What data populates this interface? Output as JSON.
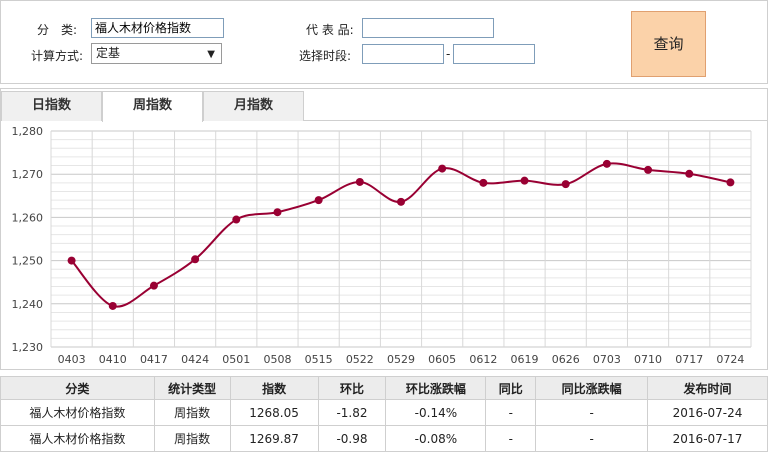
{
  "filters": {
    "category_label": "分　类:",
    "category_value": "福人木材价格指数",
    "calc_label": "计算方式:",
    "calc_value": "定基",
    "product_label": "代 表 品:",
    "product_value": "",
    "period_label": "选择时段:",
    "period_start": "",
    "period_sep": "-",
    "period_end": "",
    "query_label": "查询"
  },
  "tabs": [
    {
      "label": "日指数",
      "active": false
    },
    {
      "label": "周指数",
      "active": true
    },
    {
      "label": "月指数",
      "active": false
    }
  ],
  "chart_data": {
    "type": "line",
    "title": "",
    "xlabel": "",
    "ylabel": "",
    "categories": [
      "0403",
      "0410",
      "0417",
      "0424",
      "0501",
      "0508",
      "0515",
      "0522",
      "0529",
      "0605",
      "0612",
      "0619",
      "0626",
      "0703",
      "0710",
      "0717",
      "0724"
    ],
    "series": [
      {
        "values": [
          1250.0,
          1239.5,
          1244.2,
          1250.3,
          1259.5,
          1261.2,
          1264.0,
          1268.2,
          1263.6,
          1271.3,
          1268.0,
          1268.5,
          1267.7,
          1272.4,
          1271.0,
          1270.1,
          1268.1
        ],
        "color": "#990033"
      }
    ],
    "ylim": [
      1230,
      1280
    ],
    "yticks": [
      "1,230",
      "1,240",
      "1,250",
      "1,260",
      "1,270",
      "1,280"
    ],
    "grid": true
  },
  "table": {
    "headers": [
      "分类",
      "统计类型",
      "指数",
      "环比",
      "环比涨跌幅",
      "同比",
      "同比涨跌幅",
      "发布时间"
    ],
    "rows": [
      [
        "福人木材价格指数",
        "周指数",
        "1268.05",
        "-1.82",
        "-0.14%",
        "-",
        "-",
        "2016-07-24"
      ],
      [
        "福人木材价格指数",
        "周指数",
        "1269.87",
        "-0.98",
        "-0.08%",
        "-",
        "-",
        "2016-07-17"
      ]
    ]
  }
}
